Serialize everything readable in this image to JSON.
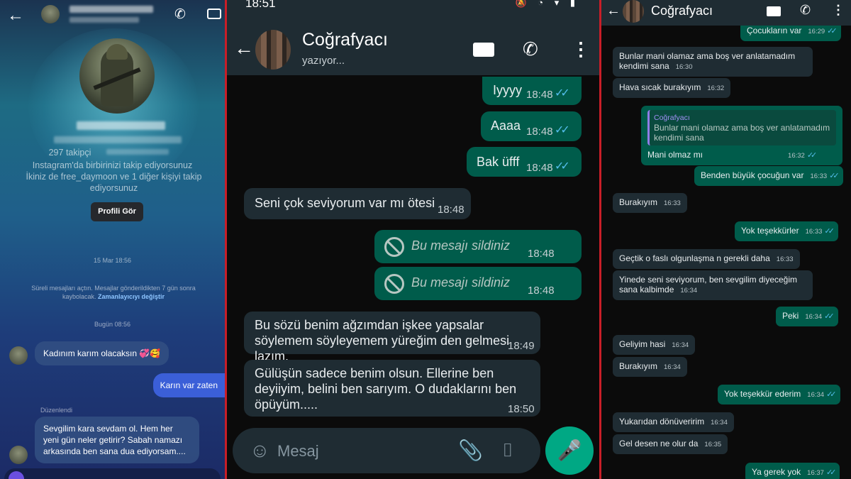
{
  "instagram": {
    "profile_title": "Profili Gör",
    "followers_line": "297 takipçi",
    "mutual_follow": "Instagram'da birbirinizi takip ediyorsunuz",
    "also_follows": "İkiniz de free_daymoon ve 1 diğer kişiyi takip ediyorsunuz",
    "date_1": "15 Mar 18:56",
    "vanish_notice": "Süreli mesajları açtın. Mesajlar gönderildikten 7 gün sonra kaybolacak.",
    "vanish_link": "Zamanlayıcıyı değiştir",
    "date_2": "Bugün 08:56",
    "msg_1": "Kadınım karım olacaksın 💞🥰",
    "msg_2": "Karın var zaten",
    "edited_label": "Düzenlendi",
    "msg_3": "Sevgilim kara sevdam ol. Hem her yeni gün neler getirir? Sabah namazı arkasında ben sana dua ediyorsam...."
  },
  "whatsapp_large": {
    "status_time": "18:51",
    "contact_name": "Coğrafyacı",
    "status": "yazıyor...",
    "messages": [
      {
        "text": "Iyyyy",
        "time": "18:48"
      },
      {
        "text": "Aaaa",
        "time": "18:48"
      },
      {
        "text": "Bak üfff",
        "time": "18:48"
      },
      {
        "text": "Seni çok seviyorum var mı ötesi",
        "time": "18:48"
      },
      {
        "text": "Bu mesajı sildiniz",
        "time": "18:48"
      },
      {
        "text": "Bu mesajı sildiniz",
        "time": "18:48"
      },
      {
        "text": "Bu sözü benim ağzımdan işkee yapsalar söylemem söyleyemem yüreğim den gelmesi lazım.",
        "time": "18:49"
      },
      {
        "text": "Gülüşün sadece benim olsun. Ellerine ben deyiiyim, belini ben sarıyım. O dudaklarını ben öpüyüm.....",
        "time": "18:50"
      }
    ],
    "input_placeholder": "Mesaj"
  },
  "whatsapp_small": {
    "contact_name": "Coğrafyacı",
    "messages": [
      {
        "text": "Çocukların var",
        "time": "16:29"
      },
      {
        "text": "Bunlar mani olamaz ama boş ver anlatamadım kendimi sana",
        "time": "16:30"
      },
      {
        "text": "Hava sıcak burakıyım",
        "time": "16:32"
      },
      {
        "quote_author": "Coğrafyacı",
        "quote_text": "Bunlar mani olamaz ama boş ver anlatamadım kendimi sana",
        "text": "Mani olmaz mı",
        "time": "16:32"
      },
      {
        "text": "Benden büyük çocuğun var",
        "time": "16:33"
      },
      {
        "text": "Burakıyım",
        "time": "16:33"
      },
      {
        "text": "Yok teşekkürler",
        "time": "16:33"
      },
      {
        "text": "Geçtik o faslı olgunlaşma n gerekli daha",
        "time": "16:33"
      },
      {
        "text": "Yinede seni seviyorum, ben sevgilim diyeceğim sana kalbimde",
        "time": "16:34"
      },
      {
        "text": "Peki",
        "time": "16:34"
      },
      {
        "text": "Geliyim hasi",
        "time": "16:34"
      },
      {
        "text": "Burakıyım",
        "time": "16:34"
      },
      {
        "text": "Yok teşekkür ederim",
        "time": "16:34"
      },
      {
        "text": "Yukarıdan dönüveririm",
        "time": "16:34"
      },
      {
        "text": "Gel desen ne olur da",
        "time": "16:35"
      },
      {
        "text": "Ya gerek yok",
        "time": "16:37"
      }
    ]
  },
  "colors": {
    "divider": "#c81e28",
    "wa_out": "#005c4b",
    "wa_in": "#1f2c33",
    "wa_accent": "#00a884",
    "read_ticks": "#53bdeb"
  }
}
